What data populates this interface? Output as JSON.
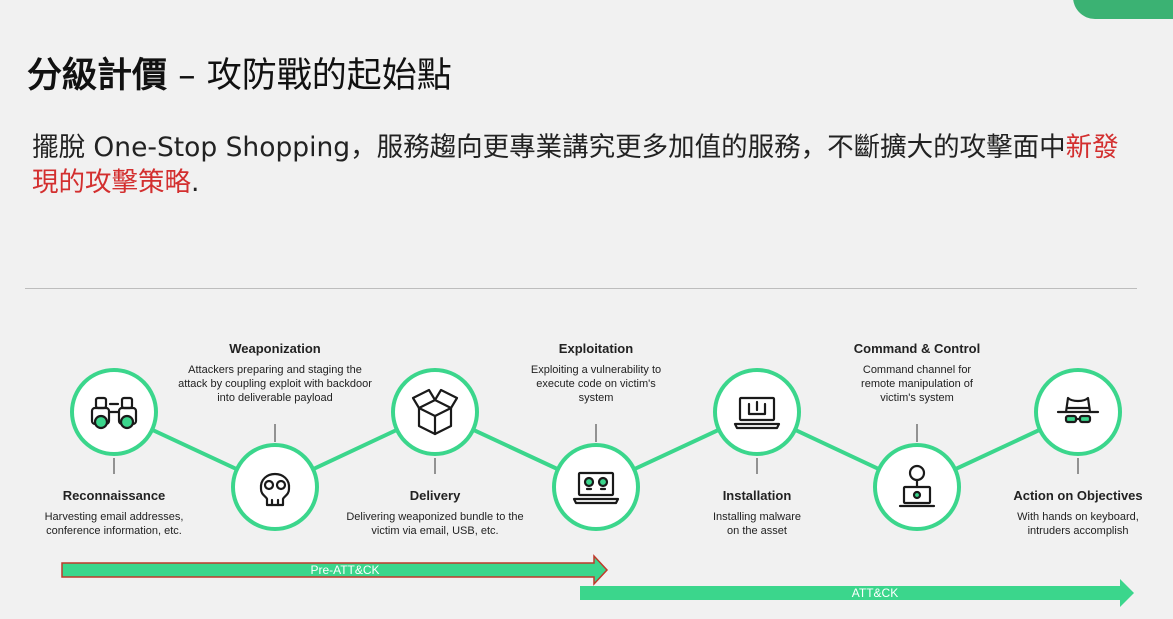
{
  "title": {
    "bold": "分級計價",
    "rest": " – 攻防戰的起始點"
  },
  "subtitle": {
    "part1": "擺脫 One-Stop Shopping，服務趨向更專業講究更多加值的服務，不斷擴大的攻擊面中",
    "highlight": "新發現的攻擊策略",
    "end": "."
  },
  "colors": {
    "accent": "#3bd68c",
    "dark_green": "#1d8f55",
    "highlight": "#d32f2f"
  },
  "stages": [
    {
      "name": "Reconnaissance",
      "desc": "Harvesting email addresses,\nconference information, etc.",
      "icon": "binoculars-icon"
    },
    {
      "name": "Weaponization",
      "desc": "Attackers preparing and staging the\nattack by coupling exploit with backdoor\ninto deliverable payload",
      "icon": "skull-icon"
    },
    {
      "name": "Delivery",
      "desc": "Delivering weaponized bundle to the\nvictim via email, USB, etc.",
      "icon": "box-icon"
    },
    {
      "name": "Exploitation",
      "desc": "Exploiting a vulnerability to\nexecute code on victim's\nsystem",
      "icon": "laptop-skulls-icon"
    },
    {
      "name": "Installation",
      "desc": "Installing malware\non the asset",
      "icon": "laptop-install-icon"
    },
    {
      "name": "Command & Control",
      "desc": "Command channel for\nremote manipulation of\nvictim's system",
      "icon": "laptop-command-icon"
    },
    {
      "name": "Action on Objectives",
      "desc": "With hands on keyboard,\nintruders accomplish",
      "icon": "spy-hat-icon"
    }
  ],
  "arrows": {
    "pre": "Pre-ATT&CK",
    "attck": "ATT&CK"
  }
}
